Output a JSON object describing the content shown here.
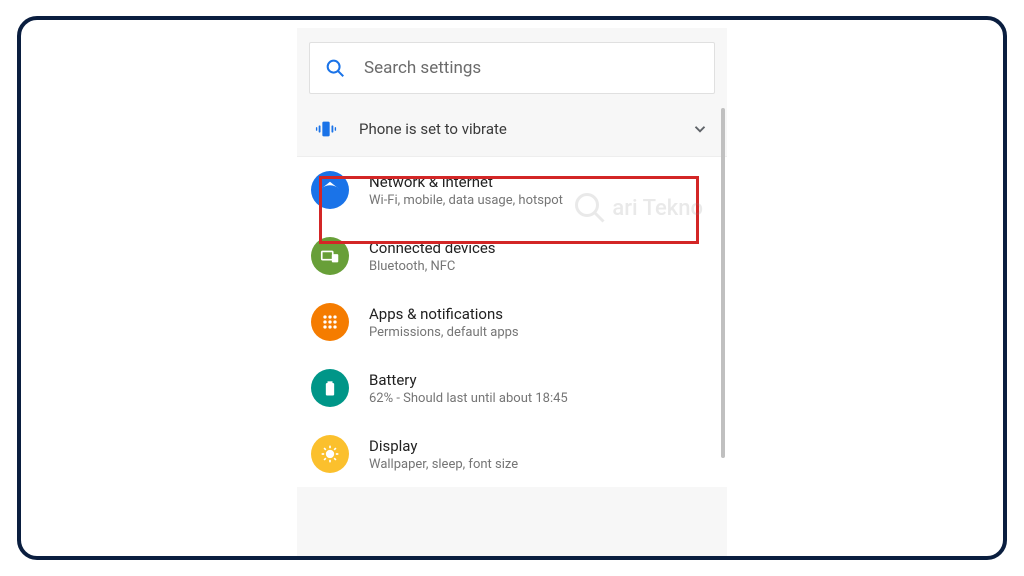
{
  "search": {
    "placeholder": "Search settings"
  },
  "status": {
    "text": "Phone is set to vibrate"
  },
  "items": [
    {
      "title": "Network & internet",
      "subtitle": "Wi-Fi, mobile, data usage, hotspot",
      "icon": "wifi",
      "color": "blue"
    },
    {
      "title": "Connected devices",
      "subtitle": "Bluetooth, NFC",
      "icon": "devices",
      "color": "green"
    },
    {
      "title": "Apps & notifications",
      "subtitle": "Permissions, default apps",
      "icon": "apps",
      "color": "orange"
    },
    {
      "title": "Battery",
      "subtitle": "62% - Should last until about 18:45",
      "icon": "battery",
      "color": "teal"
    },
    {
      "title": "Display",
      "subtitle": "Wallpaper, sleep, font size",
      "icon": "display",
      "color": "amber"
    }
  ],
  "watermark": "ari Tekno"
}
